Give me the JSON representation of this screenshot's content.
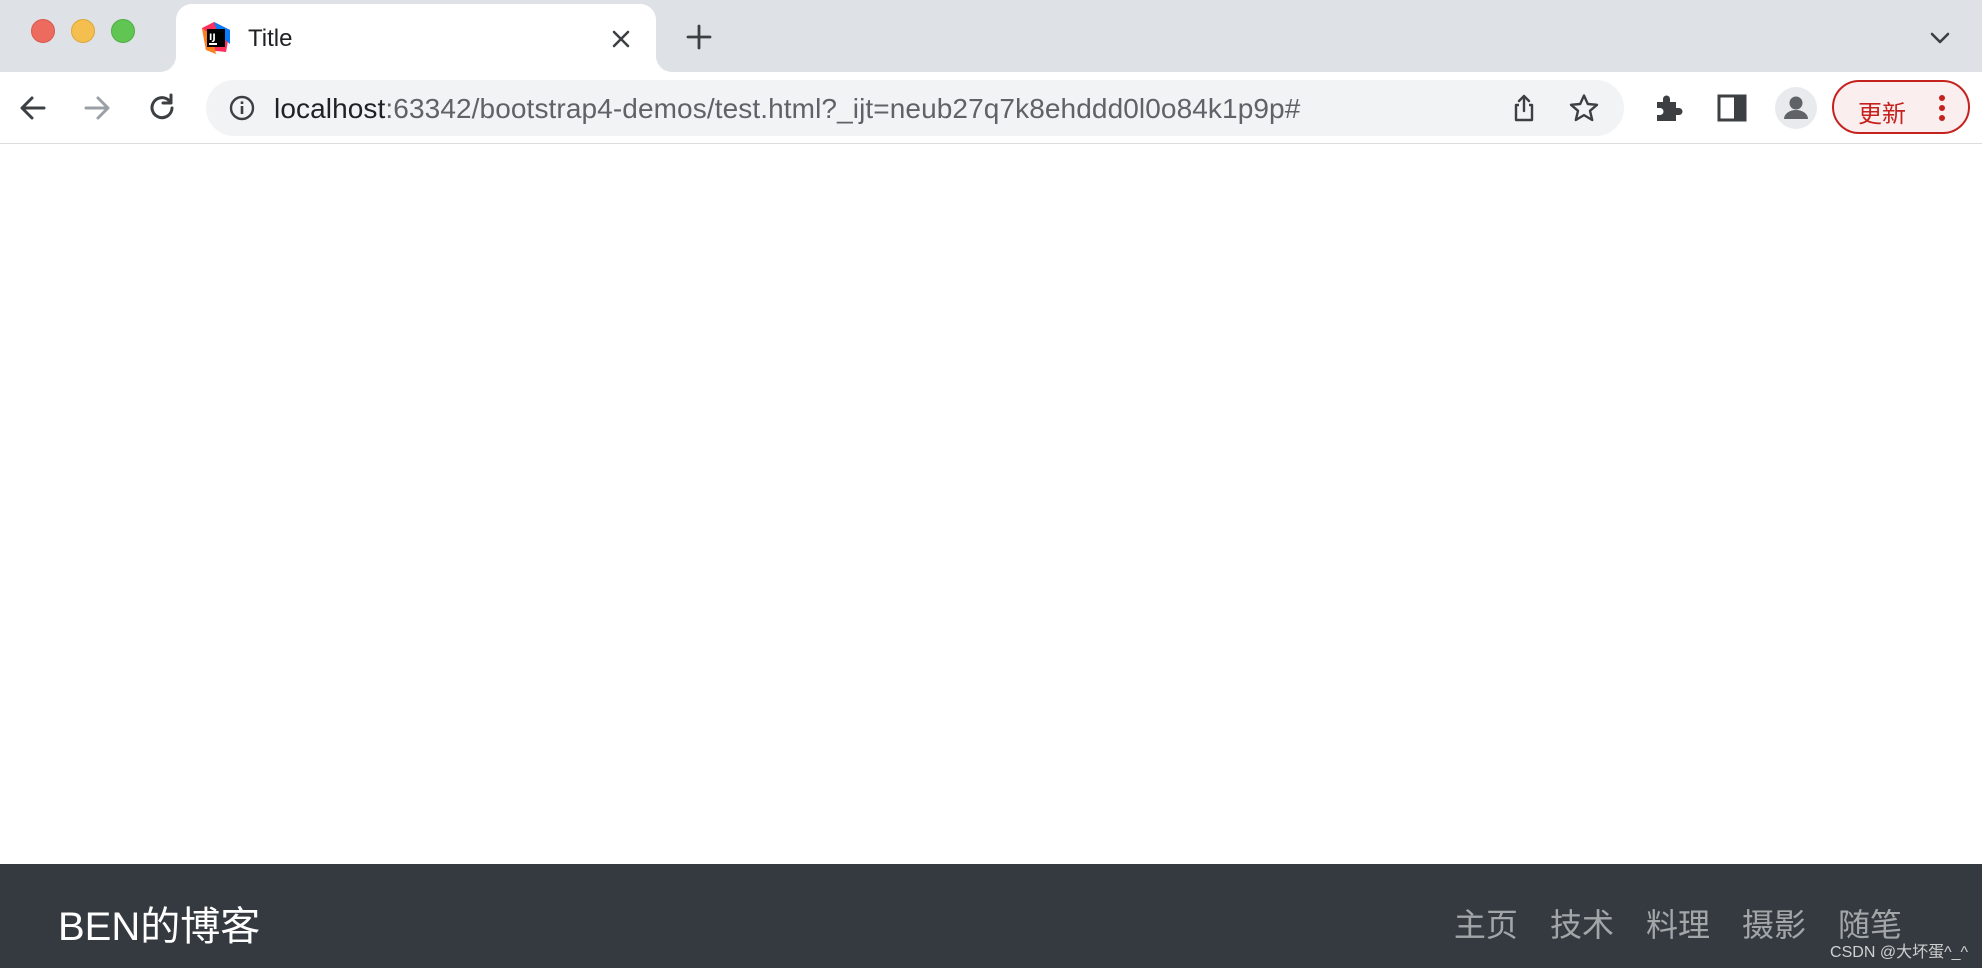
{
  "browser": {
    "tab": {
      "title": "Title",
      "favicon": "intellij-icon"
    },
    "omnibox": {
      "host": "localhost",
      "path": ":63342/bootstrap4-demos/test.html?_ijt=neub27q7k8ehddd0l0o84k1p9p#"
    },
    "update_button": {
      "label": "更新"
    },
    "colors": {
      "tabstrip": "#dee1e6",
      "update_red": "#c5221f"
    }
  },
  "page": {
    "navbar": {
      "brand": "BEN的博客",
      "links": [
        "主页",
        "技术",
        "料理",
        "摄影",
        "随笔"
      ],
      "background": "#343a40"
    },
    "watermark": "CSDN @大坏蛋^_^"
  }
}
